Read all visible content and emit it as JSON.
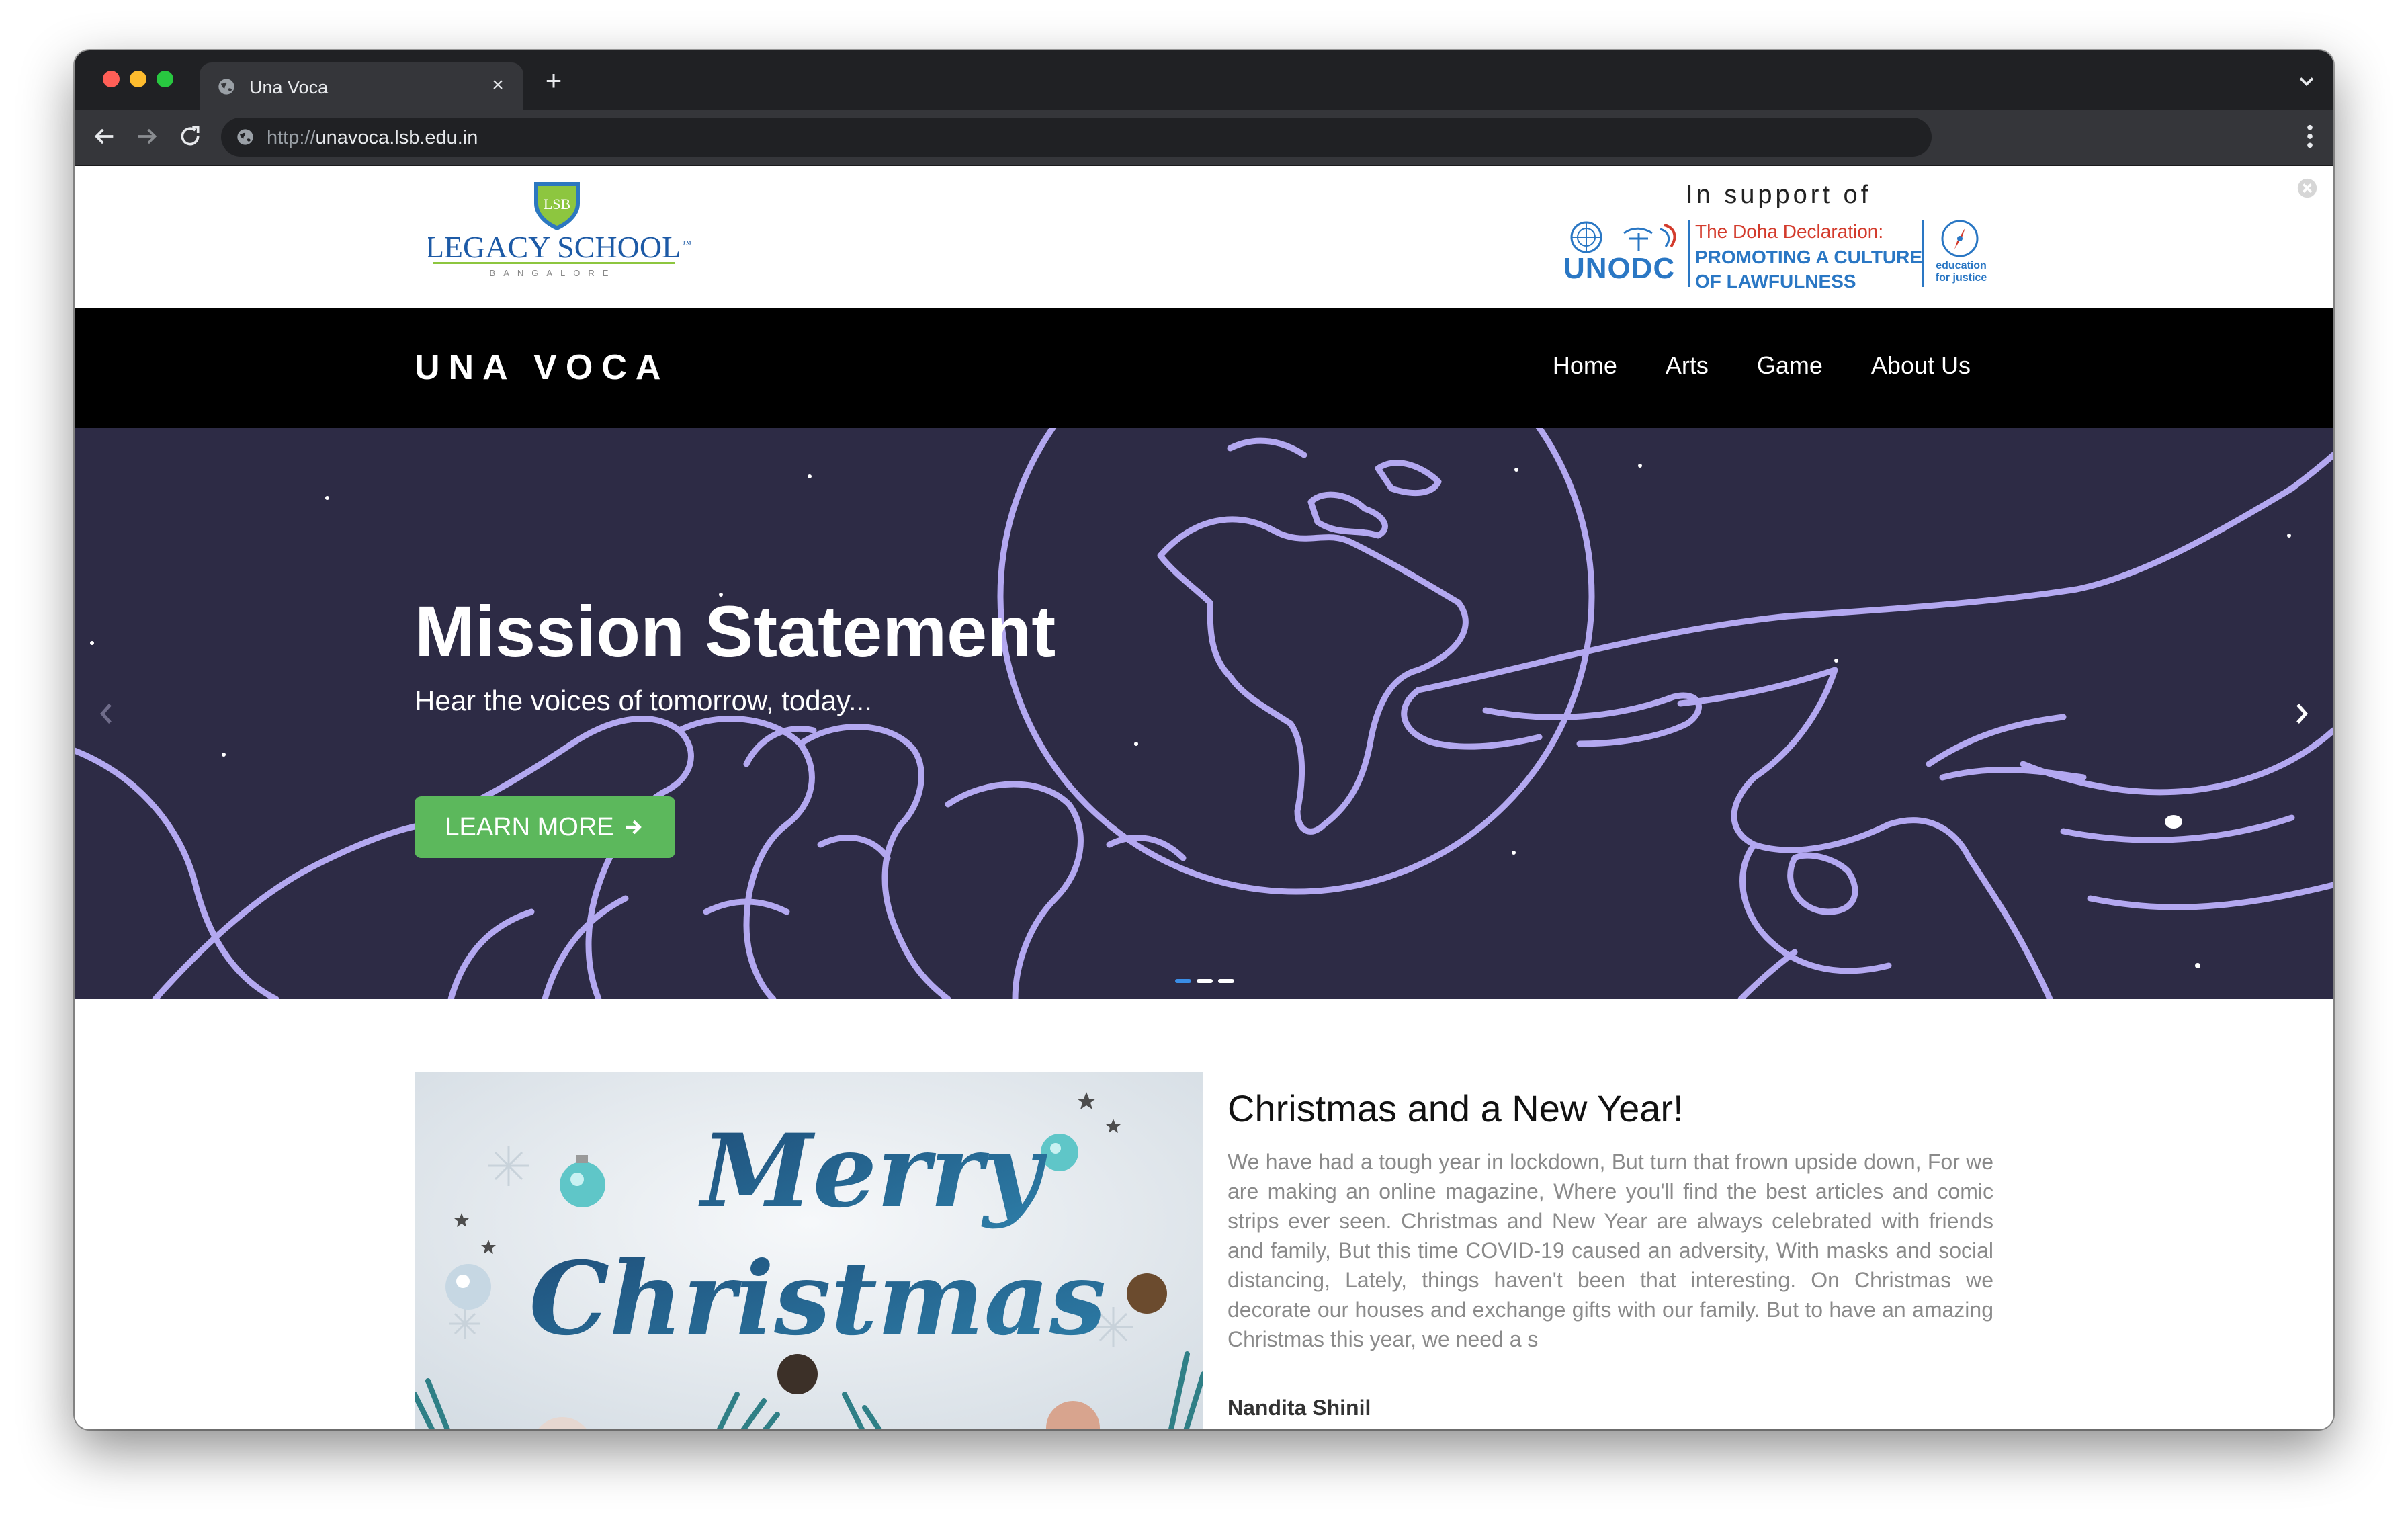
{
  "browser": {
    "tab_title": "Una Voca",
    "url_scheme": "http://",
    "url_host": "unavoca.lsb.edu.in"
  },
  "header": {
    "school_name": "LEGACY SCHOOL",
    "school_tm": "™",
    "school_city": "BANGALORE",
    "school_badge": "LSB",
    "support_title": "In support of",
    "unodc": "UNODC",
    "doha_line1": "The Doha Declaration:",
    "doha_line2": "PROMOTING A CULTURE",
    "doha_line3": "OF LAWFULNESS",
    "e4j_line1": "education",
    "e4j_line2": "for justice"
  },
  "navbar": {
    "brand": "UNA VOCA",
    "links": [
      "Home",
      "Arts",
      "Game",
      "About Us"
    ]
  },
  "hero": {
    "title": "Mission Statement",
    "subtitle": "Hear the voices of tomorrow, today...",
    "button_label": "LEARN MORE",
    "slide_count": 3,
    "active_slide": 1
  },
  "post": {
    "image_text_1": "Merry",
    "image_text_2": "Christmas",
    "title": "Christmas and a New Year!",
    "excerpt": "We have had a tough year in lockdown, But turn that frown upside down, For we are making an online magazine, Where you'll find the best articles and comic strips ever seen. Christmas and New Year are always celebrated with friends and family, But this time COVID-19 caused an adversity, With masks and social distancing, Lately, things haven't been that interesting. On Christmas we decorate our houses and exchange gifts with our family. But to have an amazing Christmas this year, we need a s",
    "author": "Nandita Shinil"
  },
  "colors": {
    "hero_bg": "#2d2b45",
    "hero_lines": "#b3a8f0",
    "button_green": "#5cb85c",
    "unodc_blue": "#2a77c4"
  }
}
